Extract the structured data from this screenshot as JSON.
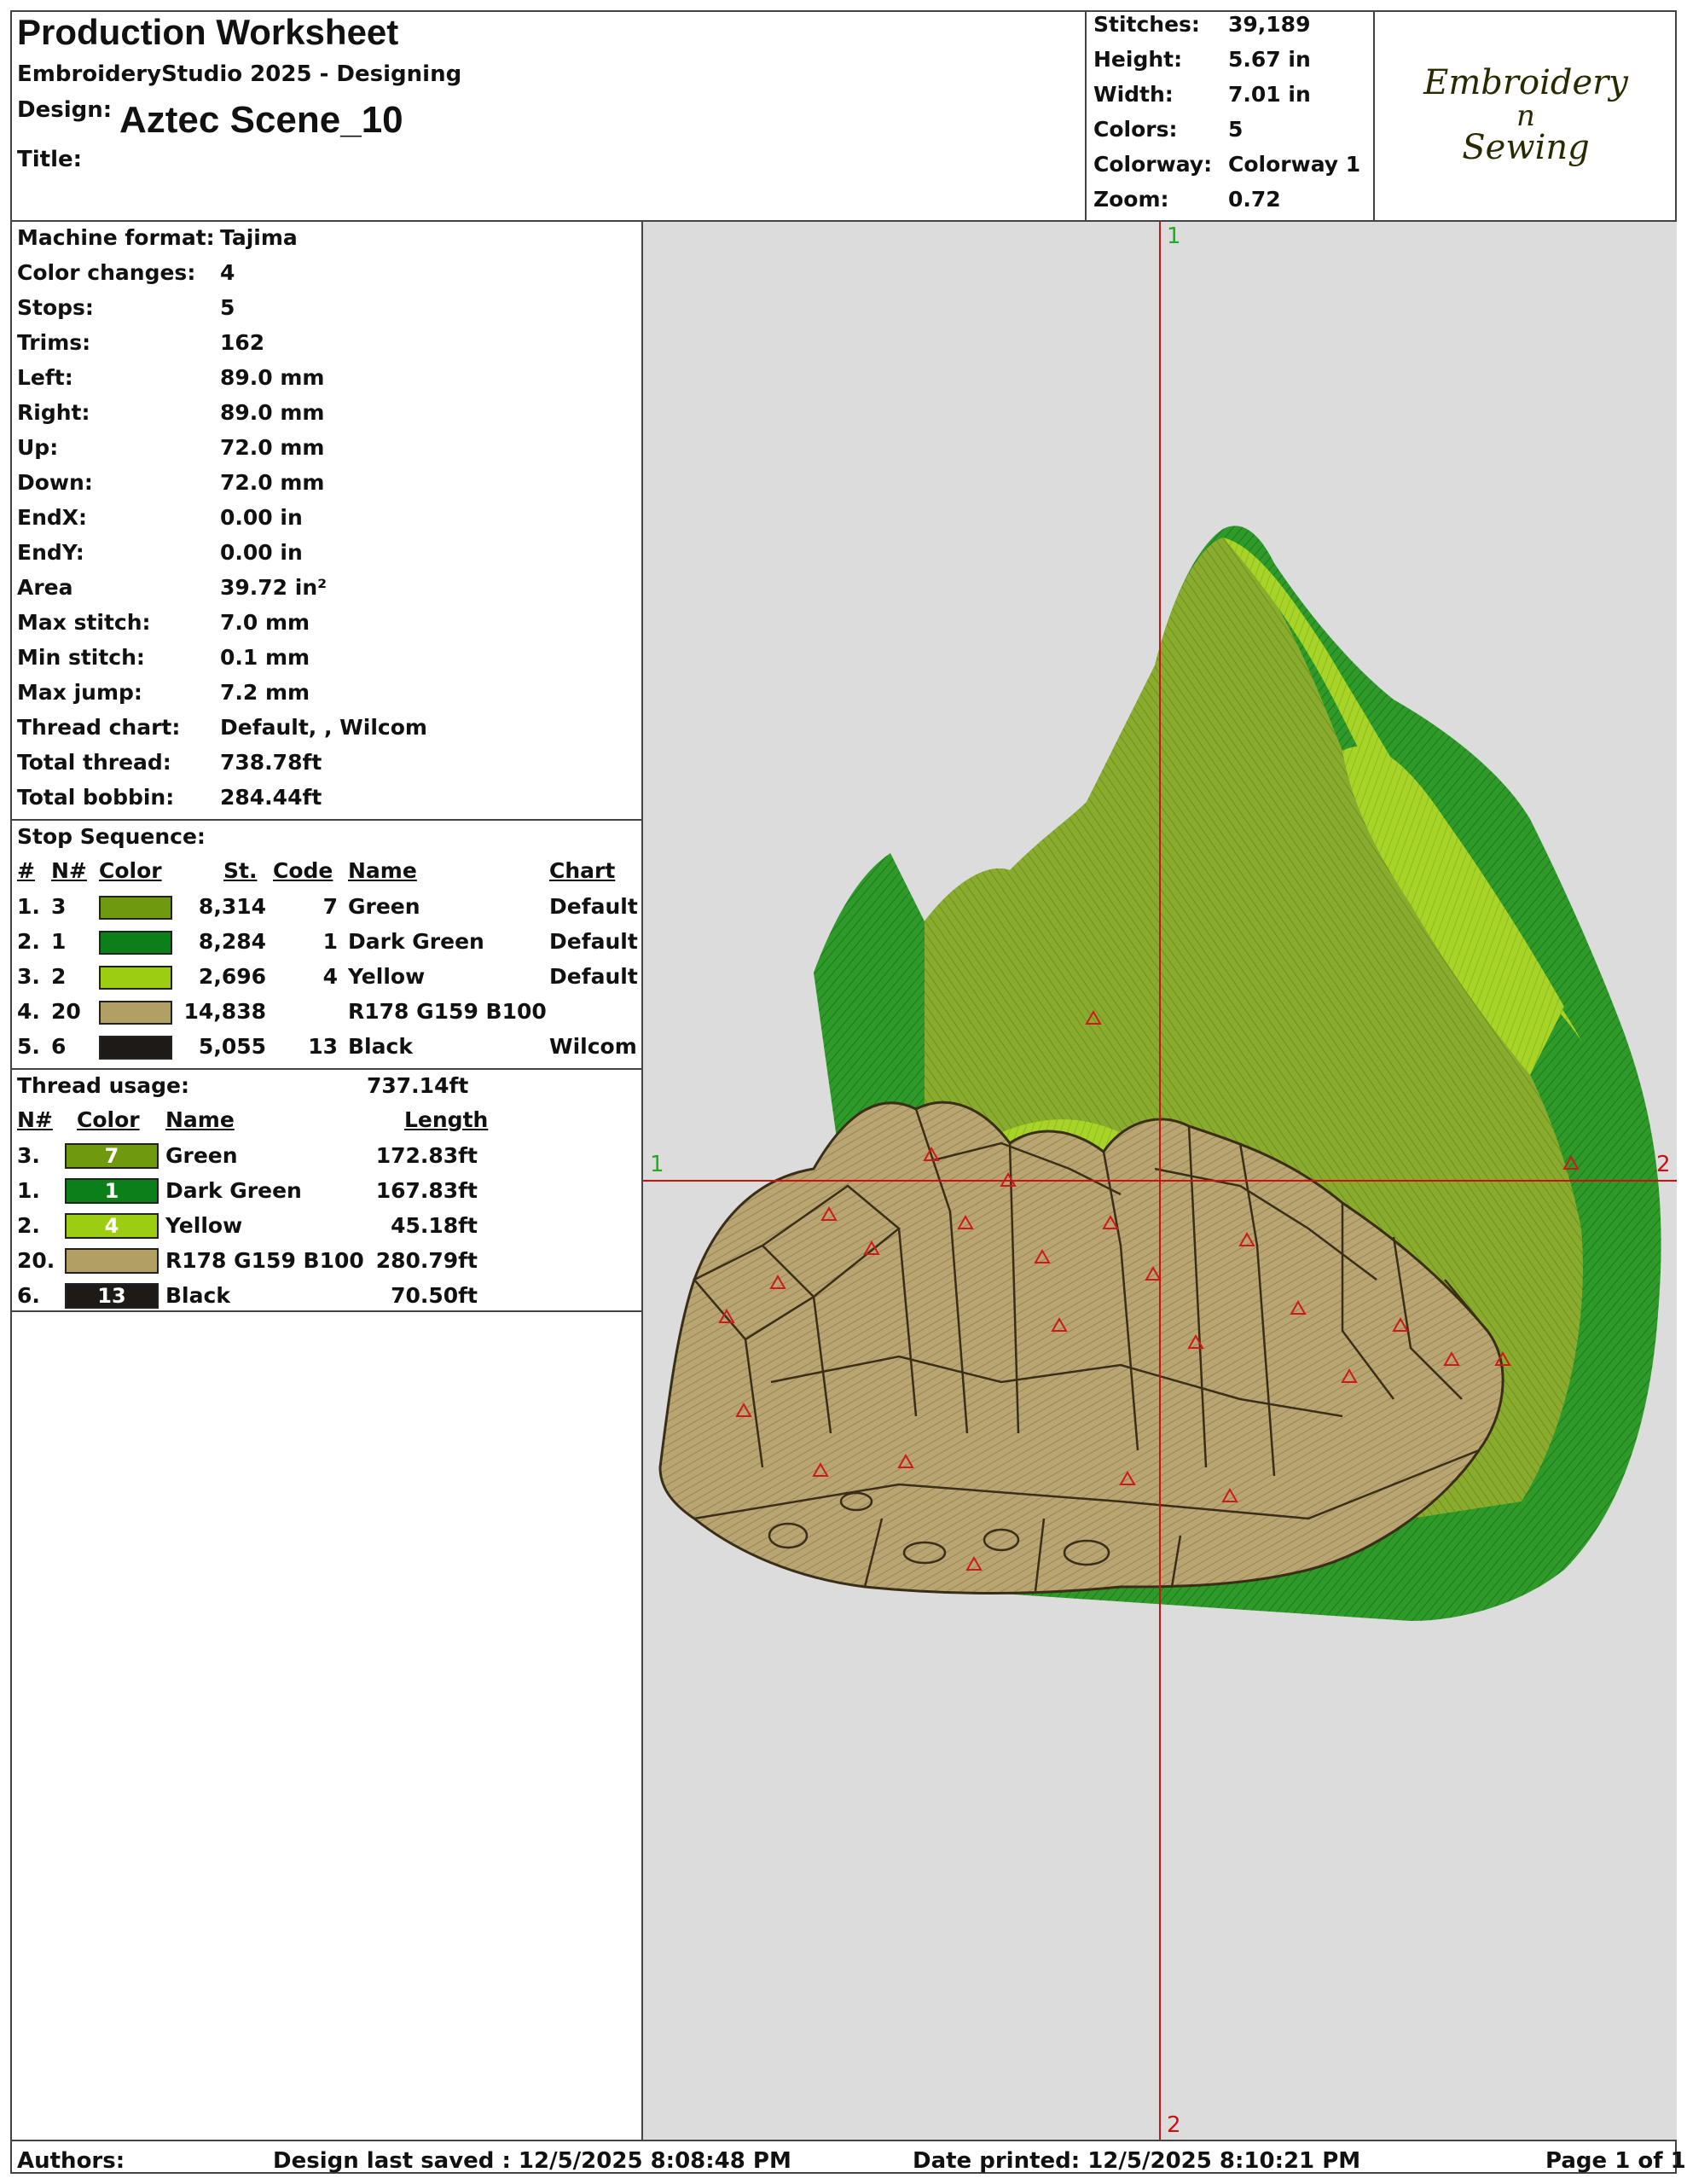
{
  "header": {
    "title": "Production Worksheet",
    "subtitle": "EmbroideryStudio 2025 - Designing",
    "design_label": "Design:",
    "design_value": "Aztec Scene_10",
    "title_label": "Title:"
  },
  "stats": [
    {
      "k": "Stitches:",
      "v": "39,189"
    },
    {
      "k": "Height:",
      "v": "5.67 in"
    },
    {
      "k": "Width:",
      "v": "7.01 in"
    },
    {
      "k": "Colors:",
      "v": "5"
    },
    {
      "k": "Colorway:",
      "v": "Colorway 1"
    },
    {
      "k": "Zoom:",
      "v": "0.72"
    }
  ],
  "logo": {
    "line1": "Embroidery",
    "line2": "n",
    "line3": "Sewing"
  },
  "info": [
    {
      "k": "Machine format:",
      "v": "Tajima"
    },
    {
      "k": "Color changes:",
      "v": "4"
    },
    {
      "k": "Stops:",
      "v": "5"
    },
    {
      "k": "Trims:",
      "v": "162"
    },
    {
      "k": "Left:",
      "v": "89.0 mm"
    },
    {
      "k": "Right:",
      "v": "89.0 mm"
    },
    {
      "k": "Up:",
      "v": "72.0 mm"
    },
    {
      "k": "Down:",
      "v": "72.0 mm"
    },
    {
      "k": "EndX:",
      "v": "0.00 in"
    },
    {
      "k": "EndY:",
      "v": "0.00 in"
    },
    {
      "k": "Area",
      "v": " 39.72 in²"
    },
    {
      "k": "Max stitch:",
      "v": "7.0 mm"
    },
    {
      "k": "Min stitch:",
      "v": "0.1 mm"
    },
    {
      "k": "Max jump:",
      "v": "7.2 mm"
    },
    {
      "k": "Thread chart:",
      "v": "Default, , Wilcom"
    },
    {
      "k": "Total thread:",
      "v": "738.78ft"
    },
    {
      "k": "Total bobbin:",
      "v": "284.44ft"
    }
  ],
  "stop_sequence": {
    "title": "Stop Sequence:",
    "headers": {
      "idx": "#",
      "n": "N#",
      "color": "Color",
      "st": "St.",
      "code": "Code",
      "name": "Name",
      "chart": "Chart"
    },
    "rows": [
      {
        "idx": "1.",
        "n": "3",
        "color": "#6f9a10",
        "st": "8,314",
        "code": "7",
        "name": "Green",
        "chart": "Default"
      },
      {
        "idx": "2.",
        "n": "1",
        "color": "#0b7f18",
        "st": "8,284",
        "code": "1",
        "name": "Dark Green",
        "chart": "Default"
      },
      {
        "idx": "3.",
        "n": "2",
        "color": "#9ccd10",
        "st": "2,696",
        "code": "4",
        "name": "Yellow",
        "chart": "Default"
      },
      {
        "idx": "4.",
        "n": "20",
        "color": "#b29f64",
        "st": "14,838",
        "code": "",
        "name": "R178 G159 B100",
        "chart": ""
      },
      {
        "idx": "5.",
        "n": "6",
        "color": "#1e1a18",
        "st": "5,055",
        "code": "13",
        "name": "Black",
        "chart": "Wilcom"
      }
    ]
  },
  "thread_usage": {
    "title": "Thread usage:",
    "total": "737.14ft",
    "headers": {
      "n": "N#",
      "color": "Color",
      "name": "Name",
      "length": "Length"
    },
    "rows": [
      {
        "n": "3.",
        "color": "#6f9a10",
        "code": "7",
        "name": "Green",
        "length": "172.83ft"
      },
      {
        "n": "1.",
        "color": "#0b7f18",
        "code": "1",
        "name": "Dark Green",
        "length": "167.83ft"
      },
      {
        "n": "2.",
        "color": "#9ccd10",
        "code": "4",
        "name": "Yellow",
        "length": "45.18ft"
      },
      {
        "n": "20.",
        "color": "#b29f64",
        "code": "",
        "name": "R178 G159 B100",
        "length": "280.79ft"
      },
      {
        "n": "6.",
        "color": "#1e1a18",
        "code": "13",
        "name": "Black",
        "length": "70.50ft"
      }
    ]
  },
  "preview": {
    "axis_labels": {
      "top": "1",
      "left": "1",
      "right": "2",
      "bottom": "2"
    },
    "background": "#dcdcdc",
    "crosshair_color": "#cc1111"
  },
  "footer": {
    "authors": "Authors:",
    "saved": "Design last saved : 12/5/2025 8:08:48 PM",
    "printed": "Date printed: 12/5/2025 8:10:21 PM",
    "page": "Page 1 of 1"
  }
}
